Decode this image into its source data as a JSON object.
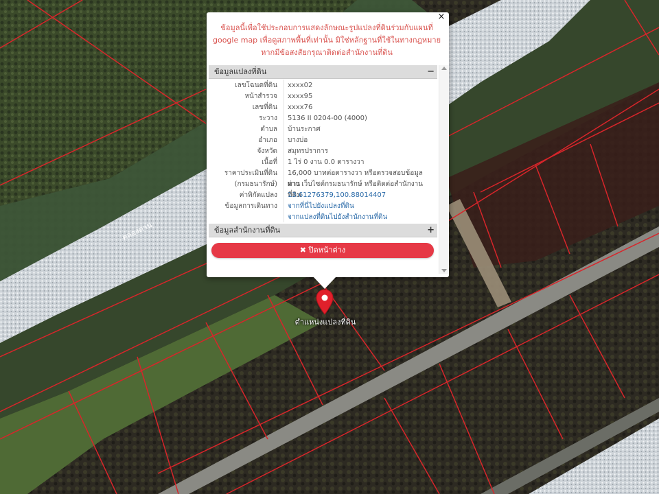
{
  "popup": {
    "close_symbol": "×",
    "notice": "ข้อมูลนี้เพื่อใช้ประกอบการแสดงลักษณะรูปแปลงที่ดินร่วมกับแผนที่ google map เพื่อดูสภาพพื้นที่เท่านั้น มิใช่หลักฐานที่ใช้ในทางกฎหมาย หากมีข้อสงสัยกรุณาติดต่อสำนักงานที่ดิน",
    "parcel_section": {
      "title": "ข้อมูลแปลงที่ดิน",
      "sign": "−"
    },
    "office_section": {
      "title": "ข้อมูลสำนักงานที่ดิน",
      "sign": "+"
    },
    "rows": [
      {
        "label": "เลขโฉนดที่ดิน",
        "value": "xxxx02"
      },
      {
        "label": "หน้าสำรวจ",
        "value": "xxxx95"
      },
      {
        "label": "เลขที่ดิน",
        "value": "xxxx76"
      },
      {
        "label": "ระวาง",
        "value": "5136 II 0204-00 (4000)"
      },
      {
        "label": "ตำบล",
        "value": "บ้านระกาศ"
      },
      {
        "label": "อำเภอ",
        "value": "บางบ่อ"
      },
      {
        "label": "จังหวัด",
        "value": "สมุทรปราการ"
      },
      {
        "label": "เนื้อที่",
        "value": "1 ไร่ 0 งาน 0.0 ตารางวา"
      },
      {
        "label": "ราคาประเมินที่ดิน",
        "value": "16,000 บาทต่อตารางวา หรือตรวจสอบข้อมูลผ่าน"
      },
      {
        "label": "(กรมธนารักษ์)",
        "value": "ทาง เว็บไซต์กรมธนารักษ์ หรือติดต่อสำนักงานที่ดิน"
      },
      {
        "label": "ค่าพิกัดแปลง",
        "value": "13.61276379,100.88014407",
        "link": true
      },
      {
        "label": "ข้อมูลการเดินทาง",
        "value": "จากที่นี่ไปยังแปลงที่ดิน",
        "link": true
      },
      {
        "label": "",
        "value": "จากแปลงที่ดินไปยังสำนักงานที่ดิน",
        "link": true
      }
    ],
    "close_button": {
      "icon": "✖",
      "label": "ปิดหน้าต่าง"
    }
  },
  "map": {
    "marker_label": "ตำแหน่งแปลงที่ดิน",
    "marker_icon": "map-pin-icon",
    "parcel_line_color": "#d8252a",
    "canal_label": "คลองด่าน"
  }
}
